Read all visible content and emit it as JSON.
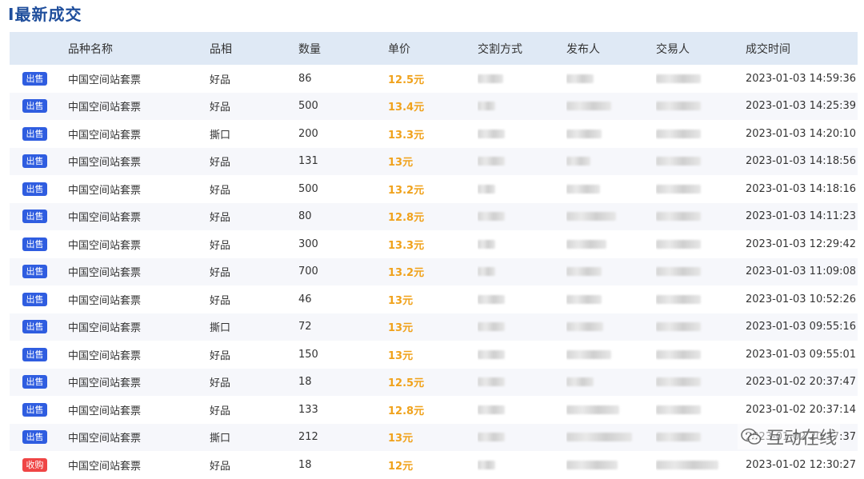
{
  "page": {
    "title": "I最新成交"
  },
  "table": {
    "headers": {
      "name": "品种名称",
      "condition": "品相",
      "quantity": "数量",
      "price": "单价",
      "delivery": "交割方式",
      "publisher": "发布人",
      "trader": "交易人",
      "time": "成交时间"
    },
    "rows": [
      {
        "type": "出售",
        "name": "中国空间站套票",
        "condition": "好品",
        "quantity": "86",
        "price": "12.5元",
        "time": "2023-01-03 14:59:36"
      },
      {
        "type": "出售",
        "name": "中国空间站套票",
        "condition": "好品",
        "quantity": "500",
        "price": "13.4元",
        "time": "2023-01-03 14:25:39"
      },
      {
        "type": "出售",
        "name": "中国空间站套票",
        "condition": "撕口",
        "quantity": "200",
        "price": "13.3元",
        "time": "2023-01-03 14:20:10"
      },
      {
        "type": "出售",
        "name": "中国空间站套票",
        "condition": "好品",
        "quantity": "131",
        "price": "13元",
        "time": "2023-01-03 14:18:56"
      },
      {
        "type": "出售",
        "name": "中国空间站套票",
        "condition": "好品",
        "quantity": "500",
        "price": "13.2元",
        "time": "2023-01-03 14:18:16"
      },
      {
        "type": "出售",
        "name": "中国空间站套票",
        "condition": "好品",
        "quantity": "80",
        "price": "12.8元",
        "time": "2023-01-03 14:11:23"
      },
      {
        "type": "出售",
        "name": "中国空间站套票",
        "condition": "好品",
        "quantity": "300",
        "price": "13.3元",
        "time": "2023-01-03 12:29:42"
      },
      {
        "type": "出售",
        "name": "中国空间站套票",
        "condition": "好品",
        "quantity": "700",
        "price": "13.2元",
        "time": "2023-01-03 11:09:08"
      },
      {
        "type": "出售",
        "name": "中国空间站套票",
        "condition": "好品",
        "quantity": "46",
        "price": "13元",
        "time": "2023-01-03 10:52:26"
      },
      {
        "type": "出售",
        "name": "中国空间站套票",
        "condition": "撕口",
        "quantity": "72",
        "price": "13元",
        "time": "2023-01-03 09:55:16"
      },
      {
        "type": "出售",
        "name": "中国空间站套票",
        "condition": "好品",
        "quantity": "150",
        "price": "13元",
        "time": "2023-01-03 09:55:01"
      },
      {
        "type": "出售",
        "name": "中国空间站套票",
        "condition": "好品",
        "quantity": "18",
        "price": "12.5元",
        "time": "2023-01-02 20:37:47"
      },
      {
        "type": "出售",
        "name": "中国空间站套票",
        "condition": "好品",
        "quantity": "133",
        "price": "12.8元",
        "time": "2023-01-02 20:37:14"
      },
      {
        "type": "出售",
        "name": "中国空间站套票",
        "condition": "撕口",
        "quantity": "212",
        "price": "13元",
        "time": "2023-01-02 20:37:37"
      },
      {
        "type": "收购",
        "name": "中国空间站套票",
        "condition": "好品",
        "quantity": "18",
        "price": "12元",
        "time": "2023-01-02 12:30:27"
      }
    ]
  },
  "colors": {
    "sell_badge": "#2f5de0",
    "buy_badge": "#ef4545",
    "price": "#f0a21c",
    "title": "#1f4e9c",
    "header_bg": "#dfe9f5"
  },
  "watermark": {
    "text": "互动在线",
    "icon": "wechat-icon"
  }
}
